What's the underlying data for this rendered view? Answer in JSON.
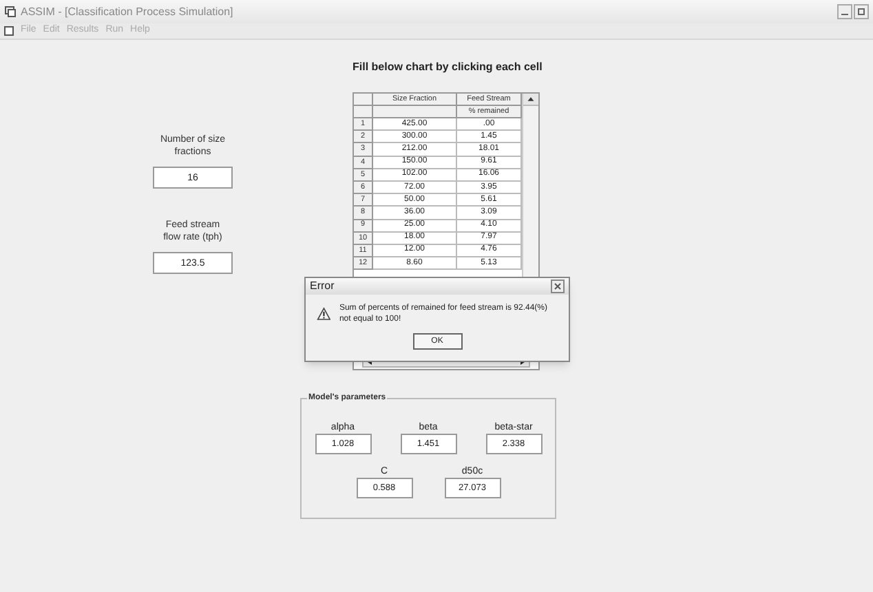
{
  "window": {
    "title": "ASSIM - [Classification Process Simulation]"
  },
  "menu": [
    {
      "label": "File"
    },
    {
      "label": "Edit"
    },
    {
      "label": "Results"
    },
    {
      "label": "Run"
    },
    {
      "label": "Help"
    }
  ],
  "heading": "Fill below chart by clicking each cell",
  "fields": [
    {
      "label": "Number of size fractions",
      "value": "16"
    },
    {
      "label": "Feed stream flow rate (tph)",
      "value": "123.5"
    }
  ],
  "table": {
    "columns": [
      "",
      "Size Fraction",
      "Feed Stream"
    ],
    "subheader": "% remained",
    "rows": [
      [
        "1",
        "425.00",
        ".00"
      ],
      [
        "2",
        "300.00",
        "1.45"
      ],
      [
        "3",
        "212.00",
        "18.01"
      ],
      [
        "4",
        "150.00",
        "9.61"
      ],
      [
        "5",
        "102.00",
        "16.06"
      ],
      [
        "6",
        "72.00",
        "3.95"
      ],
      [
        "7",
        "50.00",
        "5.61"
      ],
      [
        "8",
        "36.00",
        "3.09"
      ],
      [
        "9",
        "25.00",
        "4.10"
      ],
      [
        "10",
        "18.00",
        "7.97"
      ],
      [
        "11",
        "12.00",
        "4.76"
      ],
      [
        "12",
        "8.60",
        "5.13"
      ]
    ]
  },
  "parameters": {
    "title": "Model's parameters",
    "rows": [
      [
        {
          "label": "alpha",
          "value": "1.028"
        },
        {
          "label": "beta",
          "value": "1.451"
        },
        {
          "label": "beta-star",
          "value": "2.338"
        }
      ],
      [
        {
          "label": "C",
          "value": "0.588"
        },
        {
          "label": "d50c",
          "value": "27.073"
        }
      ]
    ]
  },
  "dialog": {
    "title": "Error",
    "message": "Sum of percents of remained for feed stream is 92.44(%) not equal to 100!",
    "button": "OK"
  }
}
